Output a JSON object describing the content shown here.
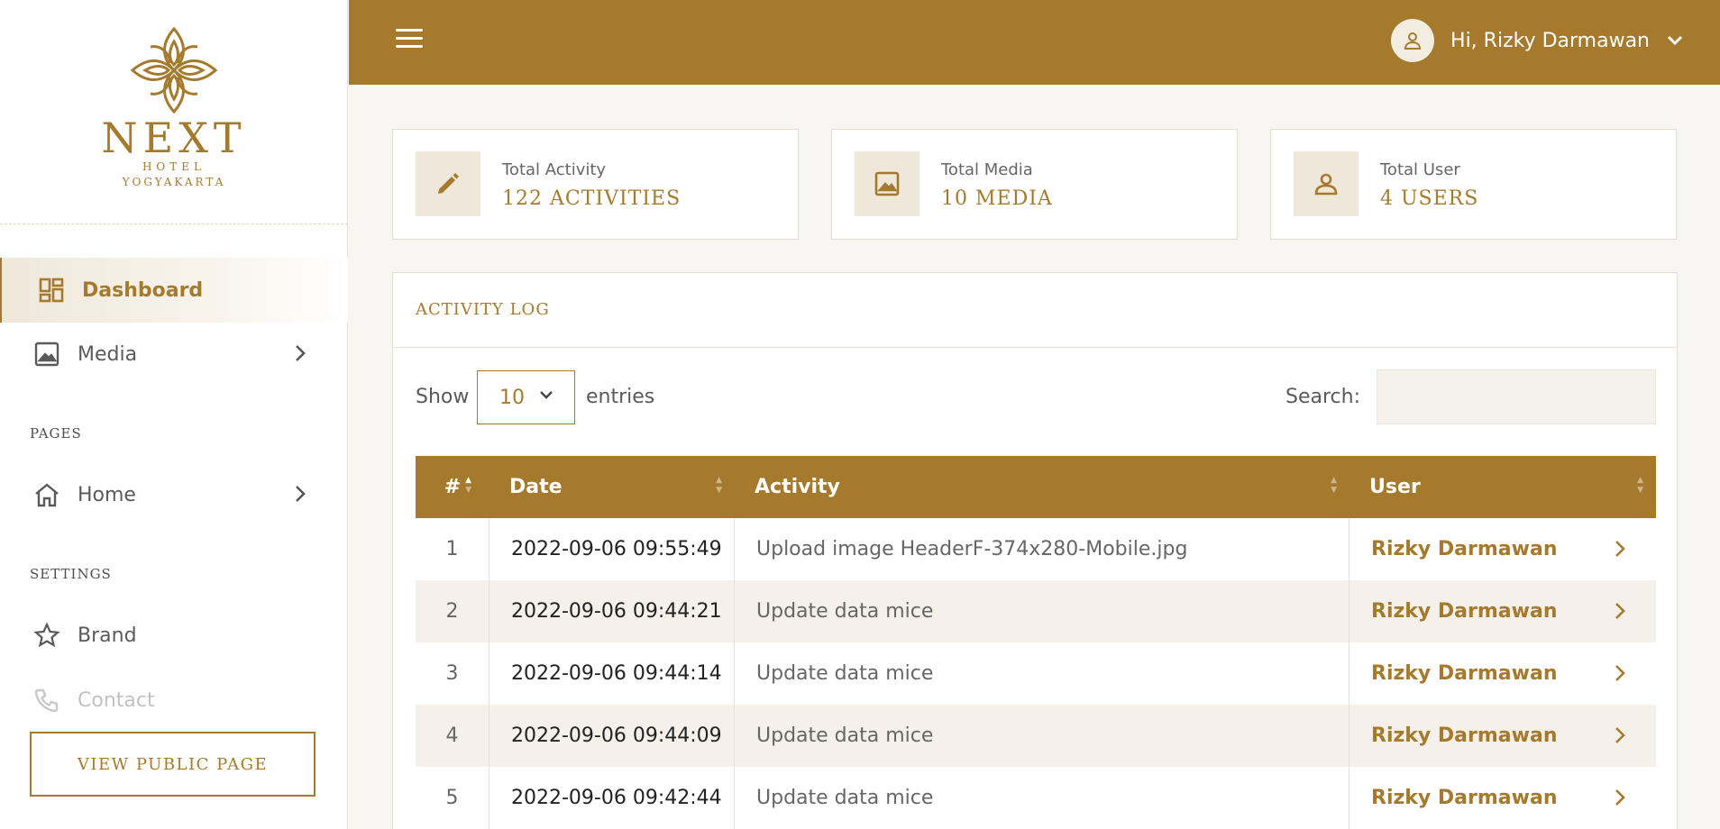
{
  "brand": {
    "name": "NEXT",
    "sub1": "HOTEL",
    "sub2": "YOGYAKARTA",
    "accent_color": "#a57a2c"
  },
  "sidebar": {
    "items": [
      {
        "label": "Dashboard",
        "icon": "dashboard-icon",
        "active": true
      },
      {
        "label": "Media",
        "icon": "image-icon",
        "has_submenu": true
      },
      {
        "label": "Home",
        "icon": "home-icon",
        "has_submenu": true
      },
      {
        "label": "Brand",
        "icon": "star-icon"
      },
      {
        "label": "Contact",
        "icon": "phone-icon"
      }
    ],
    "sections": {
      "pages": "PAGES",
      "settings": "SETTINGS"
    },
    "public_button": "VIEW PUBLIC PAGE"
  },
  "header": {
    "user_greeting": "Hi, Rizky Darmawan",
    "menu_icon": "hamburger-icon",
    "avatar_icon": "user-icon"
  },
  "stats": [
    {
      "label": "Total Activity",
      "value": "122 ACTIVITIES",
      "icon": "pencil-icon"
    },
    {
      "label": "Total Media",
      "value": "10 MEDIA",
      "icon": "image-icon"
    },
    {
      "label": "Total User",
      "value": "4 USERS",
      "icon": "user-icon"
    }
  ],
  "activity_log": {
    "title": "ACTIVITY LOG",
    "show_label": "Show",
    "entries_value": "10",
    "entries_label": "entries",
    "search_label": "Search:",
    "search_value": "",
    "columns": [
      "#",
      "Date",
      "Activity",
      "User"
    ],
    "rows": [
      {
        "num": "1",
        "date": "2022-09-06 09:55:49",
        "activity": "Upload image HeaderF-374x280-Mobile.jpg",
        "user": "Rizky Darmawan"
      },
      {
        "num": "2",
        "date": "2022-09-06 09:44:21",
        "activity": "Update data mice",
        "user": "Rizky Darmawan"
      },
      {
        "num": "3",
        "date": "2022-09-06 09:44:14",
        "activity": "Update data mice",
        "user": "Rizky Darmawan"
      },
      {
        "num": "4",
        "date": "2022-09-06 09:44:09",
        "activity": "Update data mice",
        "user": "Rizky Darmawan"
      },
      {
        "num": "5",
        "date": "2022-09-06 09:42:44",
        "activity": "Update data mice",
        "user": "Rizky Darmawan"
      }
    ]
  }
}
